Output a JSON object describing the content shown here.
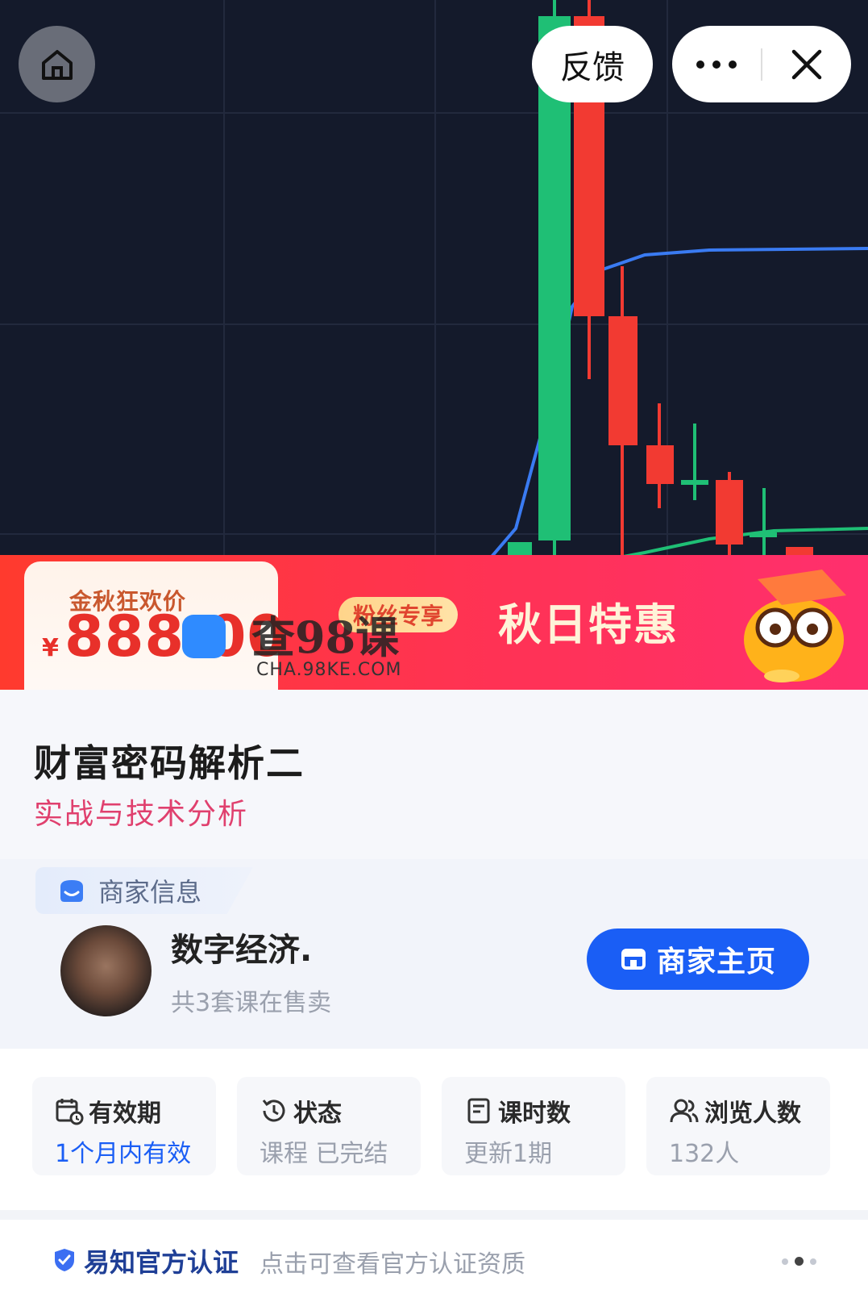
{
  "header": {
    "feedback_label": "反馈",
    "icons": [
      "home-icon",
      "more-icon",
      "close-icon"
    ]
  },
  "promo": {
    "label": "金秋狂欢价",
    "currency": "¥",
    "price": "888.00",
    "fans_tag": "粉丝专享",
    "autumn_label": "秋日特惠"
  },
  "watermark": {
    "text": "查98课",
    "url": "CHA.98KE.COM"
  },
  "course": {
    "title": "财富密码解析二",
    "subtitle": "实战与技术分析"
  },
  "merchant": {
    "section_label": "商家信息",
    "name": "数字经济.",
    "course_count": "共3套课在售卖",
    "home_button": "商家主页"
  },
  "stats": [
    {
      "label": "有效期",
      "value": "1个月内有效",
      "icon": "calendar-clock-icon"
    },
    {
      "label": "状态",
      "value": "课程 已完结",
      "icon": "history-icon"
    },
    {
      "label": "课时数",
      "value": "更新1期",
      "icon": "document-icon"
    },
    {
      "label": "浏览人数",
      "value": "132人",
      "icon": "users-icon"
    }
  ],
  "auth": {
    "title": "易知官方认证",
    "description": "点击可查看官方认证资质"
  },
  "colors": {
    "accent_blue": "#1a5ef5",
    "price_red": "#e8302a",
    "subtitle_pink": "#e0406e",
    "candle_up": "#1fbf75",
    "candle_down": "#f23a32",
    "ma_blue": "#3a7bf2"
  }
}
